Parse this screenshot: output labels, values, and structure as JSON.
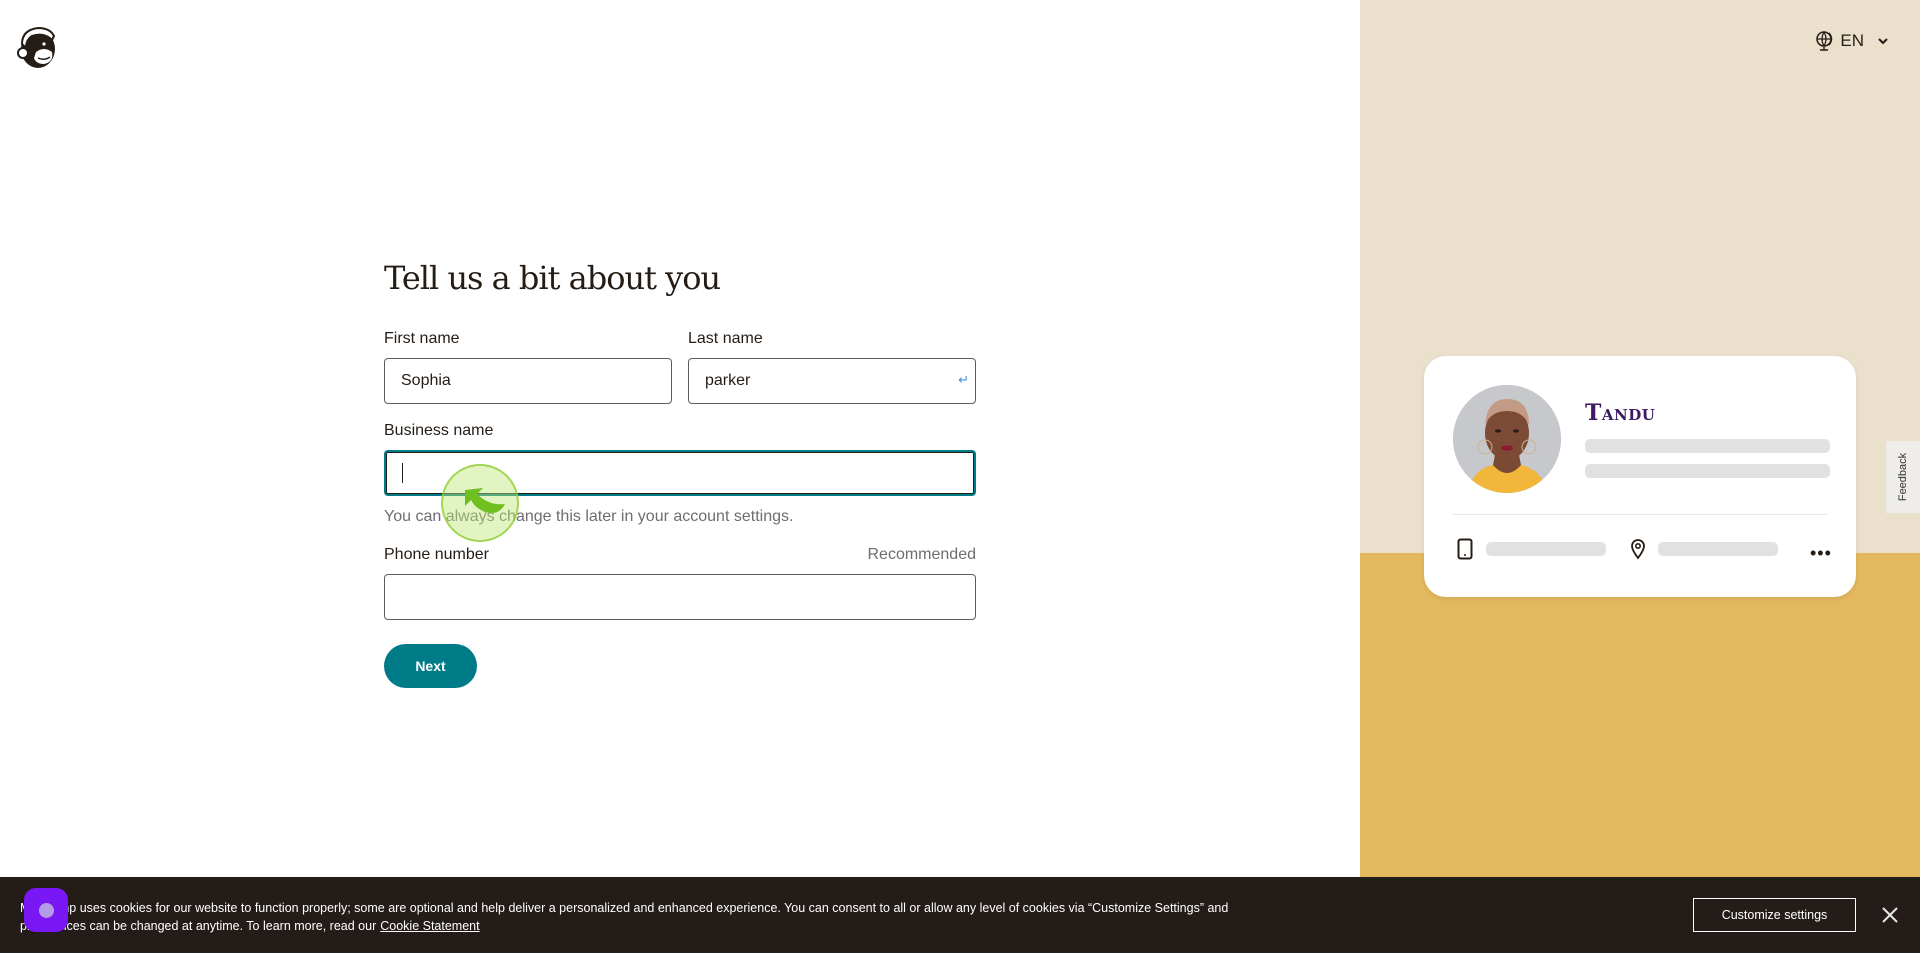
{
  "header": {
    "logo_icon": "mailchimp-freddie-logo-icon",
    "language": {
      "icon": "globe-icon",
      "label": "EN",
      "chevron": "chevron-down-icon"
    }
  },
  "form": {
    "title": "Tell us a bit about you",
    "first_name": {
      "label": "First name",
      "value": "Sophia"
    },
    "last_name": {
      "label": "Last name",
      "value": "parker",
      "trailing_icon": "enter-return-icon"
    },
    "business_name": {
      "label": "Business name",
      "value": "",
      "helper": "You can always change this later in your account settings."
    },
    "phone_number": {
      "label": "Phone number",
      "hint": "Recommended",
      "value": ""
    },
    "next_label": "Next"
  },
  "preview_card": {
    "brand": "Tandu",
    "icons": [
      "mobile-phone-icon",
      "location-pin-icon",
      "more-horizontal-icon"
    ],
    "more_label": "•••"
  },
  "feedback": {
    "label": "Feedback"
  },
  "cookie_banner": {
    "text_line": "Mailchimp uses cookies for our website to function properly; some are optional and help deliver a personalized and enhanced experience. You can consent to all or allow any level of cookies via “Customize Settings” and preferences can be changed at anytime. To learn more, read our",
    "link_label": "Cookie Statement",
    "customize_label": "Customize settings",
    "close_icon": "close-icon"
  },
  "colors": {
    "accent": "#007c89",
    "text": "#241c15",
    "right_top_bg": "#ebe0cb",
    "right_bottom_bg": "#e4b85e",
    "brand_purple": "#3d1a63",
    "banner_bg": "#241c18",
    "assist_badge": "#7a18f5"
  }
}
